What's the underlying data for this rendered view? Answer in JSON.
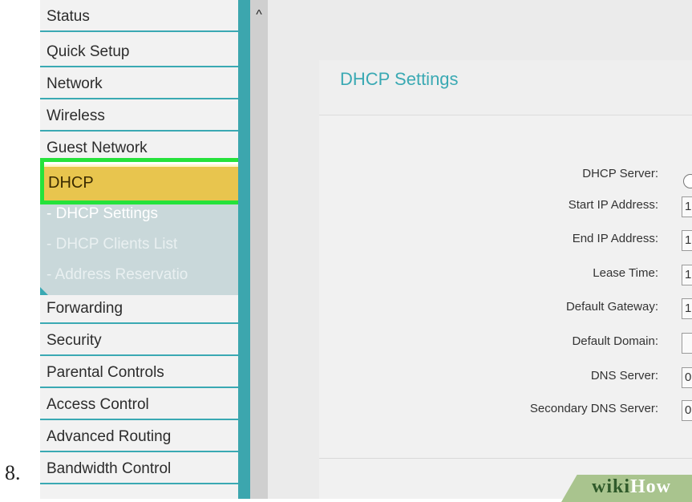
{
  "step_number": "8.",
  "sidebar": {
    "items_top": [
      "Status",
      "Quick Setup",
      "Network",
      "Wireless",
      "Guest Network"
    ],
    "selected": "DHCP",
    "subitems": [
      "- DHCP Settings",
      "- DHCP Clients List",
      "- Address Reservatio"
    ],
    "items_bottom": [
      "Forwarding",
      "Security",
      "Parental Controls",
      "Access Control",
      "Advanced Routing",
      "Bandwidth Control"
    ]
  },
  "scrollbar": {
    "up_arrow": "^"
  },
  "main": {
    "panel_title": "DHCP Settings",
    "form": {
      "labels": [
        "DHCP Server:",
        "Start IP Address:",
        "End IP Address:",
        "Lease Time:",
        "Default Gateway:",
        "Default Domain:",
        "DNS Server:",
        "Secondary DNS Server:"
      ],
      "values": [
        "",
        "1",
        "1",
        "1",
        "1",
        "",
        "0",
        "0"
      ]
    }
  },
  "watermark": {
    "part1": "wiki",
    "part2": "How"
  },
  "colors": {
    "accent": "#3aa9b3",
    "highlight": "#e8c54e",
    "focus_border": "#25e23b"
  }
}
